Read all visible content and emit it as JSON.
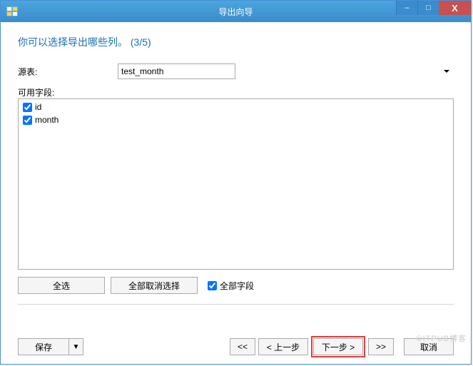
{
  "window": {
    "title": "导出向导",
    "minimize": "–",
    "maximize": "□",
    "close": "X"
  },
  "heading": "你可以选择导出哪些列。 (3/5)",
  "source": {
    "label": "源表:",
    "value": "test_month"
  },
  "fields": {
    "label": "可用字段:",
    "items": [
      {
        "name": "id",
        "checked": true
      },
      {
        "name": "month",
        "checked": true
      }
    ]
  },
  "selection": {
    "select_all": "全选",
    "deselect_all": "全部取消选择",
    "all_fields": "全部字段",
    "all_fields_checked": true
  },
  "footer": {
    "save": "保存",
    "dropdown": "▼",
    "first": "<<",
    "prev": "< 上一步",
    "next": "下一步 >",
    "last": ">>",
    "cancel": "取消"
  },
  "watermark": "©ITPUB博客"
}
